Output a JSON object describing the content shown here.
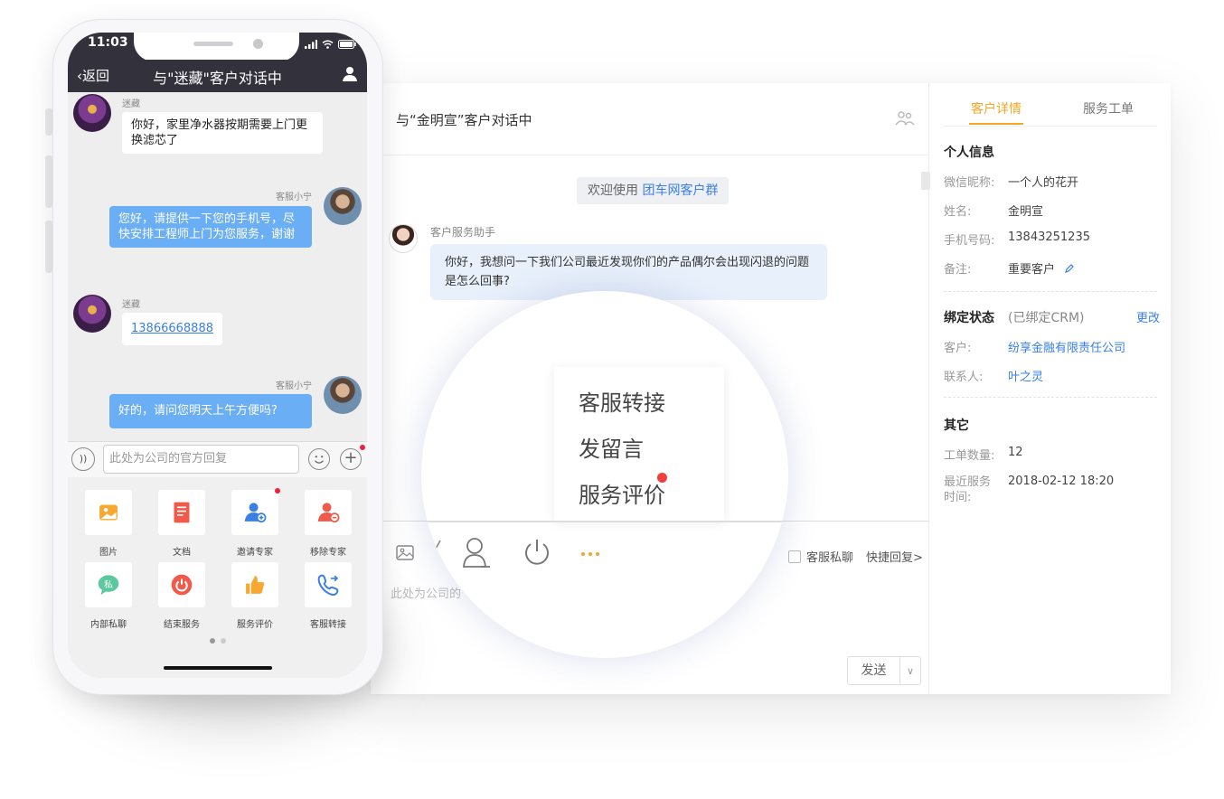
{
  "desktop": {
    "chat_title": "与“金明宣”客户对话中",
    "welcome_prefix": "欢迎使用",
    "welcome_brand": "团车网客户群",
    "agent_name": "客户服务助手",
    "agent_message": "你好，我想问一下我们公司最近发现你们的产品偶尔会出现闪退的问题是怎么回事?",
    "private_chat_label": "客服私聊",
    "quick_reply_label": "快捷回复>",
    "input_placeholder": "此处为公司的",
    "send_label": "发送",
    "menu": {
      "transfer": "客服转接",
      "leave_message": "发留言",
      "service_rating": "服务评价"
    }
  },
  "customer_panel": {
    "tabs": [
      "客户详情",
      "服务工单"
    ],
    "personal_title": "个人信息",
    "fields": {
      "wechat_label": "微信昵称:",
      "wechat_value": "一个人的花开",
      "name_label": "姓名:",
      "name_value": "金明宣",
      "phone_label": "手机号码:",
      "phone_value": "13843251235",
      "note_label": "备注:",
      "note_value": "重要客户"
    },
    "binding": {
      "title": "绑定状态",
      "status": "(已绑定CRM)",
      "change": "更改",
      "customer_label": "客户:",
      "customer_value": "纷享金融有限责任公司",
      "contact_label": "联系人:",
      "contact_value": "叶之灵"
    },
    "other": {
      "title": "其它",
      "tickets_label": "工单数量:",
      "tickets_value": "12",
      "last_service_label": "最近服务时间:",
      "last_service_value": "2018-02-12  18:20"
    }
  },
  "phone": {
    "time": "11:03",
    "back": "返回",
    "title": "与\"迷藏\"客户对话中",
    "messages": [
      {
        "from": "迷藏",
        "text": "你好，家里净水器按期需要上门更换滤芯了"
      },
      {
        "from": "客服小宁",
        "text": "您好，请提供一下您的手机号，尽快安排工程师上门为您服务，谢谢"
      },
      {
        "from": "迷藏",
        "text": "13866668888"
      },
      {
        "from": "客服小宁",
        "text": "好的，请问您明天上午方便吗?"
      }
    ],
    "input_placeholder": "此处为公司的官方回复",
    "grid": [
      {
        "label": "图片",
        "icon": "image-icon",
        "color": "#f7a830"
      },
      {
        "label": "文档",
        "icon": "document-icon",
        "color": "#f05a4a"
      },
      {
        "label": "邀请专家",
        "icon": "invite-expert-icon",
        "color": "#3a7fe6"
      },
      {
        "label": "移除专家",
        "icon": "remove-expert-icon",
        "color": "#f05a4a"
      },
      {
        "label": "内部私聊",
        "icon": "private-chat-icon",
        "color": "#5cc8a0"
      },
      {
        "label": "结束服务",
        "icon": "power-icon",
        "color": "#f05a4a"
      },
      {
        "label": "服务评价",
        "icon": "thumbs-up-icon",
        "color": "#f7a830"
      },
      {
        "label": "客服转接",
        "icon": "phone-transfer-icon",
        "color": "#3a7fe6"
      }
    ]
  }
}
